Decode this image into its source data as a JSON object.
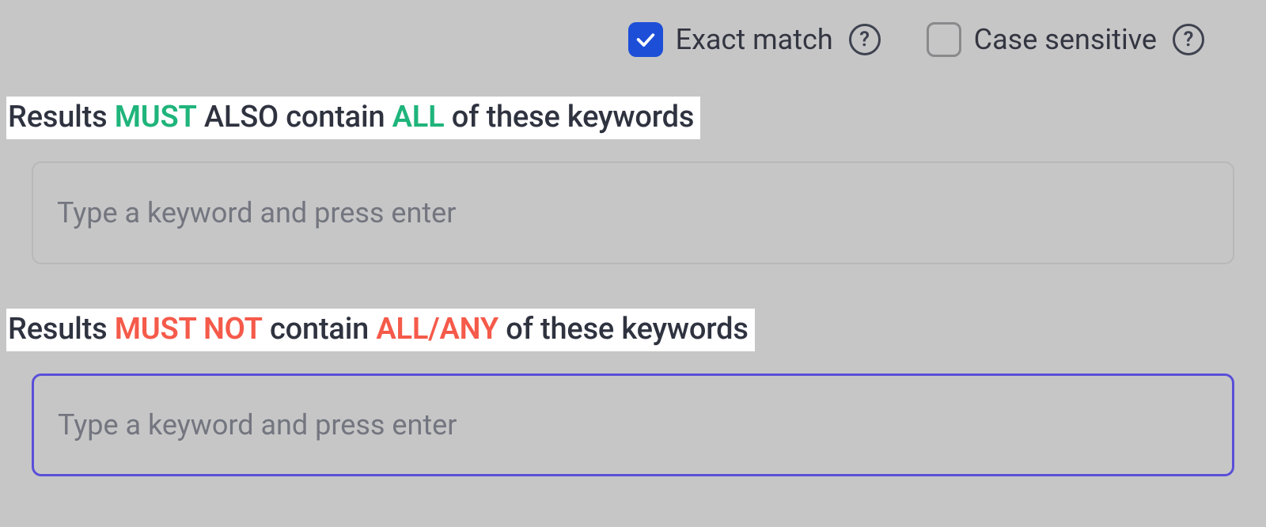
{
  "options": {
    "exact_match": {
      "label": "Exact match",
      "checked": true
    },
    "case_sensitive": {
      "label": "Case sensitive",
      "checked": false
    }
  },
  "sections": {
    "must_contain": {
      "heading_parts": {
        "p1": "Results ",
        "p2": "MUST",
        "p3": " ALSO contain ",
        "p4": "ALL",
        "p5": " of these keywords"
      },
      "placeholder": "Type a keyword and press enter",
      "focused": false
    },
    "must_not_contain": {
      "heading_parts": {
        "p1": "Results ",
        "p2": "MUST NOT",
        "p3": " contain ",
        "p4": "ALL/ANY",
        "p5": " of these keywords"
      },
      "placeholder": "Type a keyword and press enter",
      "focused": true
    }
  },
  "colors": {
    "accent_blue": "#1c4ed8",
    "accent_green": "#1fb47b",
    "accent_red": "#f55a4a",
    "focus_border": "#5a4fd8"
  }
}
